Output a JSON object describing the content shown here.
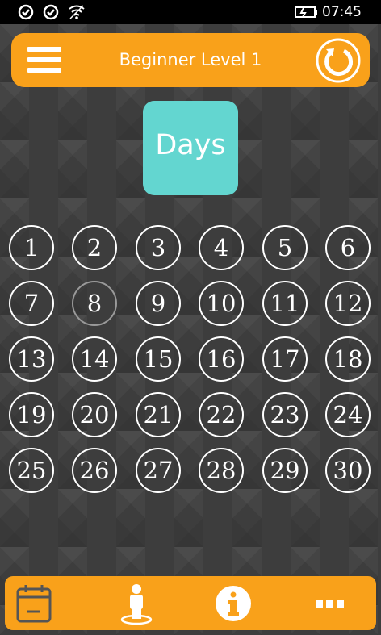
{
  "status_bar": {
    "time": "07:45",
    "icons": [
      "notification-icon",
      "notification-icon",
      "wifi-icon",
      "battery-charging-icon"
    ]
  },
  "header": {
    "title": "Beginner Level 1",
    "menu_icon": "hamburger-menu-icon",
    "refresh_icon": "refresh-icon"
  },
  "tile": {
    "label": "Days"
  },
  "days": [
    "1",
    "2",
    "3",
    "4",
    "5",
    "6",
    "7",
    "8",
    "9",
    "10",
    "11",
    "12",
    "13",
    "14",
    "15",
    "16",
    "17",
    "18",
    "19",
    "20",
    "21",
    "22",
    "23",
    "24",
    "25",
    "26",
    "27",
    "28",
    "29",
    "30"
  ],
  "dimmed_day": "8",
  "bottom_nav": {
    "items": [
      {
        "icon": "calendar-icon"
      },
      {
        "icon": "person-icon"
      },
      {
        "icon": "info-icon"
      },
      {
        "icon": "more-icon"
      }
    ]
  },
  "colors": {
    "accent": "#f9a11a",
    "tile": "#63d6d0",
    "background": "#3d3d3d"
  }
}
